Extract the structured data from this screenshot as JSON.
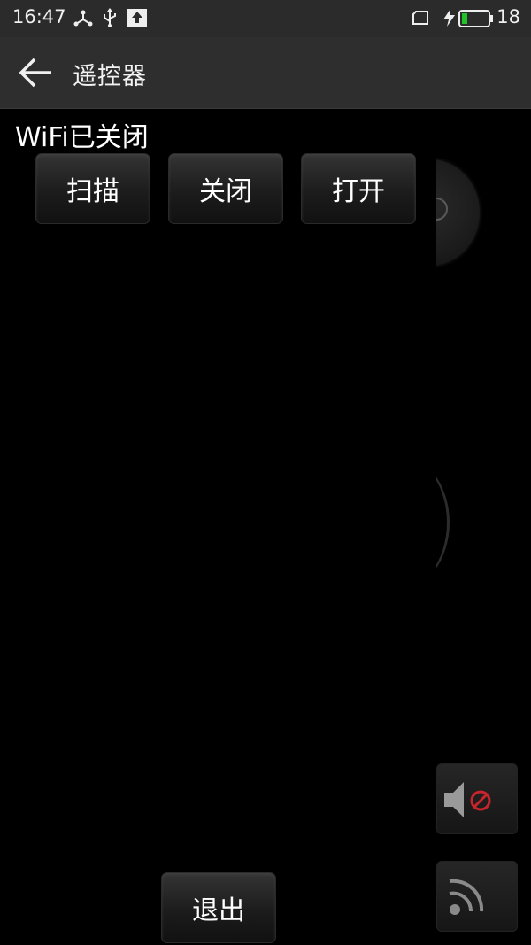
{
  "status_bar": {
    "time": "16:47",
    "battery_level": "18",
    "icons": [
      "share-icon",
      "usb-icon",
      "upload-icon",
      "sim-icon",
      "charging-icon",
      "battery-icon"
    ]
  },
  "header": {
    "title": "遥控器",
    "back_icon": "arrow-left-icon"
  },
  "wifi": {
    "status_text": "WiFi已关闭",
    "buttons": {
      "scan": "扫描",
      "close": "关闭",
      "open": "打开"
    }
  },
  "footer": {
    "exit": "退出"
  },
  "side_controls": {
    "mute_icon": "mute-icon",
    "cast_icon": "cast-icon"
  },
  "colors": {
    "background": "#000000",
    "status_bar": "#2b2b2b",
    "action_bar": "#2e2e2e",
    "battery": "#22c22a",
    "mute_badge": "#c8242b"
  }
}
